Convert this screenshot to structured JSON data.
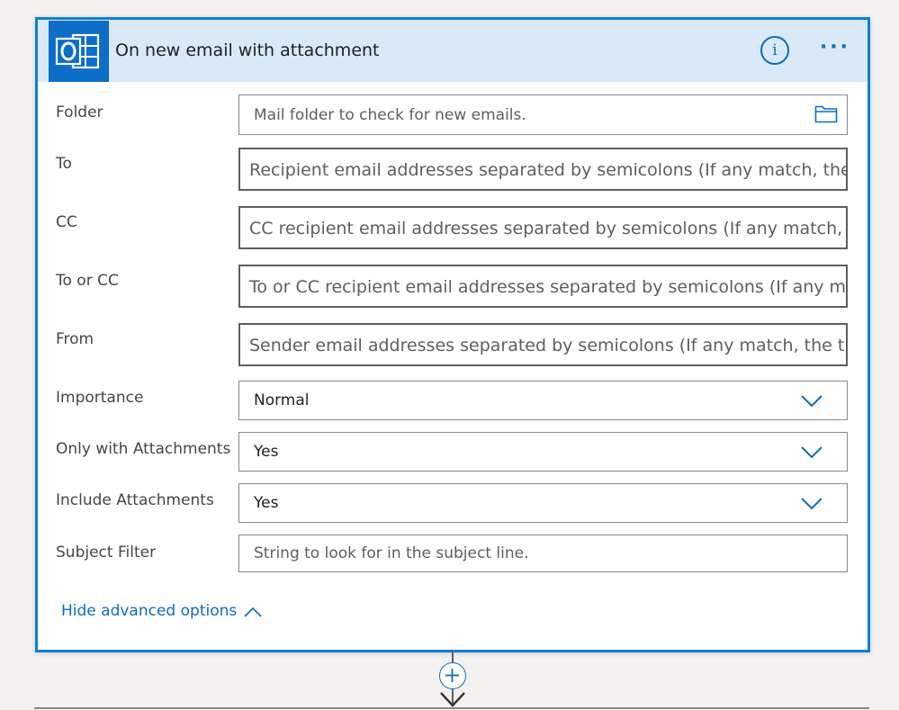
{
  "trigger": {
    "title": "On new email with attachment",
    "app_icon": "outlook-icon",
    "info_label": "i",
    "more_label": "···"
  },
  "fields": [
    {
      "label": "Folder",
      "placeholder": "Mail folder to check for new emails.",
      "icon": "folder-icon"
    },
    {
      "label": "To",
      "placeholder": "Recipient email addresses separated by semicolons (If any match, the"
    },
    {
      "label": "CC",
      "placeholder": "CC recipient email addresses separated by semicolons (If any match,"
    },
    {
      "label": "To or CC",
      "placeholder": "To or CC recipient email addresses separated by semicolons (If any m"
    },
    {
      "label": "From",
      "placeholder": "Sender email addresses separated by semicolons (If any match, the tr"
    },
    {
      "label": "Importance",
      "value": "Normal",
      "icon": "chevron-down-icon"
    },
    {
      "label": "Only with Attachments",
      "value": "Yes",
      "icon": "chevron-down-icon"
    },
    {
      "label": "Include Attachments",
      "value": "Yes",
      "icon": "chevron-down-icon"
    },
    {
      "label": "Subject Filter",
      "placeholder": "String to look for in the subject line."
    }
  ],
  "advanced_options_label": "Hide advanced options",
  "colors": {
    "accent": "#0f6cbd",
    "card_border": "#0f7fd4",
    "header_bg": "#d9e9f7",
    "icon_bg": "#0d6ec8"
  }
}
